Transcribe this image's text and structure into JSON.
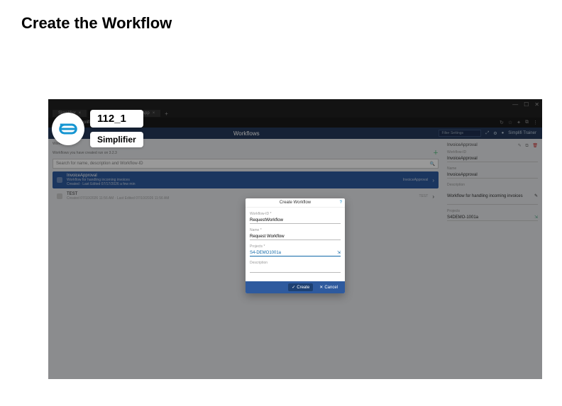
{
  "page_heading": "Create the Workflow",
  "tutorial": {
    "step_label": "112_1",
    "brand": "Simplifier"
  },
  "browser": {
    "tabs": [
      "Simplifier",
      "Simplifier",
      "TeamsApp"
    ],
    "url": "simplifier/Workflow/create",
    "rightIcons": [
      "↻",
      "☆",
      "✦",
      "⧉",
      "⋮"
    ]
  },
  "app": {
    "title": "Workflows",
    "searchPlaceholder": "Filter Settings",
    "userLabel": "Simplifi Trainer"
  },
  "list": {
    "breadcrumb": "Workflows",
    "hint": "Workflows you have created run on 3.2.3",
    "searchPlaceholder": "Search for name, description and Workflow-ID",
    "items": [
      {
        "name": "InvoiceApproval",
        "sub": "Workflow for handling incoming invoices",
        "created": "Created",
        "lastEdited": "Last Edited",
        "date": "07/17/2026 a few min",
        "tag": "InvoiceApproval"
      },
      {
        "name": "TEST",
        "sub": "",
        "created": "Created 07/10/2026 11:56 AM",
        "lastEdited": "Last Edited",
        "date": "07/10/2026 11:56 AM",
        "tag": "TEST"
      }
    ]
  },
  "detail": {
    "title": "InvoiceApproval",
    "fields": {
      "workflowIdLabel": "Workflow-ID",
      "workflowId": "InvoiceApproval",
      "nameLabel": "Name",
      "name": "InvoiceApproval",
      "descLabel": "Description",
      "desc": "Workflow for handling incoming invoices",
      "projectsLabel": "Projects",
      "projects": "S4DEMO-1001a"
    }
  },
  "modal": {
    "title": "Create Workflow",
    "fields": {
      "workflowIdLabel": "Workflow-ID *",
      "workflowId": "RequestWorkflow",
      "nameLabel": "Name *",
      "name": "Request Workflow",
      "projectsLabel": "Projects *",
      "projects": "S4-DEMO1001a",
      "descLabel": "Description",
      "desc": ""
    },
    "createLabel": "Create",
    "cancelLabel": "Cancel"
  }
}
